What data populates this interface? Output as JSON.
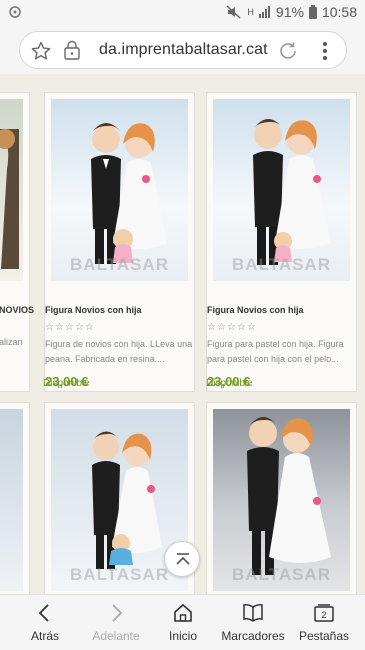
{
  "status_bar": {
    "battery": "91%",
    "time": "10:58",
    "network": "H"
  },
  "browser": {
    "url": "da.imprentabaltasar.cat"
  },
  "products": [
    {
      "left_partial_title": "NOVIOS",
      "left_partial_desc": "alizan"
    },
    {
      "title": "Figura Novios con hija",
      "stars": "☆☆☆☆☆",
      "desc_line1": "Figura de novios con hija. LLeva una",
      "desc_line2": "peana. Fabricada en resina....",
      "price": "23,00 €",
      "availability": "Disponible",
      "watermark": "BALTASAR"
    },
    {
      "title": "Figura Novios con hija",
      "stars": "☆☆☆☆☆",
      "desc_line1": "Figura para pastel con hija. Figura",
      "desc_line2": "para pastel con hija con el pelo...",
      "price": "23,00 €",
      "availability": "Disponible",
      "watermark": "BALTASAR"
    }
  ],
  "bottom_row_watermarks": [
    "BALTASAR",
    "BALTASAR"
  ],
  "bottom_nav": {
    "back": "Atrás",
    "forward": "Adelante",
    "home": "Inicio",
    "bookmarks": "Marcadores",
    "tabs": "Pestañas",
    "tab_count": "2"
  },
  "colors": {
    "price": "#7a9a1e",
    "availability": "#6c9a2a",
    "background": "#f0ede5"
  }
}
